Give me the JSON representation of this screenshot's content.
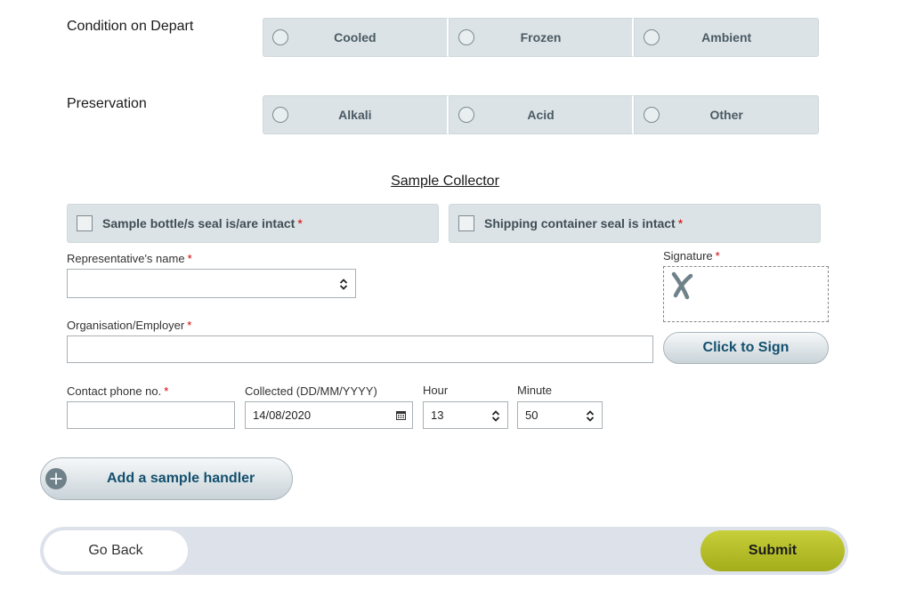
{
  "condition": {
    "label": "Condition on Depart",
    "options": [
      "Cooled",
      "Frozen",
      "Ambient"
    ]
  },
  "preservation": {
    "label": "Preservation",
    "options": [
      "Alkali",
      "Acid",
      "Other"
    ]
  },
  "collector": {
    "title": "Sample Collector",
    "check_bottle": "Sample bottle/s seal is/are intact",
    "check_container": "Shipping container seal is intact",
    "required_mark": "*",
    "rep_name_label": "Representative's name",
    "rep_name_value": "",
    "signature_label": "Signature",
    "sign_button": "Click to Sign",
    "org_label": "Organisation/Employer",
    "org_value": "",
    "phone_label": "Contact phone no.",
    "phone_value": "",
    "collected_label": "Collected (DD/MM/YYYY)",
    "collected_value": "14/08/2020",
    "hour_label": "Hour",
    "hour_value": "13",
    "minute_label": "Minute",
    "minute_value": "50"
  },
  "add_handler_button": "Add a sample handler",
  "footer": {
    "back": "Go Back",
    "submit": "Submit"
  },
  "colors": {
    "submit_green": "#b8c02a",
    "button_text_blue": "#13506e",
    "required_red": "#d00000"
  }
}
